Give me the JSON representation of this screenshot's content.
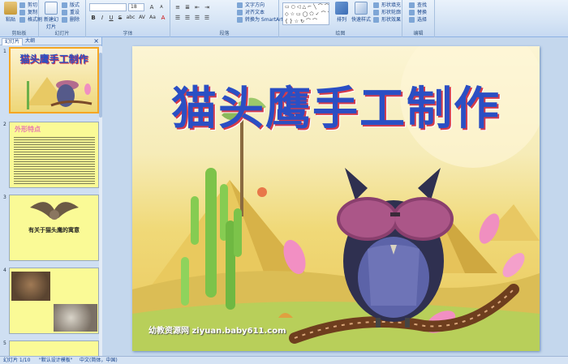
{
  "ribbon": {
    "clipboard": {
      "paste": "粘贴",
      "cut": "剪切",
      "copy": "复制",
      "format_painter": "格式刷",
      "label": "剪贴板"
    },
    "slides": {
      "new_slide": "新建幻灯片",
      "layout": "版式",
      "reset": "重设",
      "delete": "删除",
      "label": "幻灯片"
    },
    "font": {
      "family": "",
      "size": "18",
      "bold": "B",
      "italic": "I",
      "underline": "U",
      "strike": "S",
      "shadow": "abc",
      "spacing": "AV",
      "case": "Aa",
      "grow": "A",
      "shrink": "A",
      "clear": "A",
      "color": "A",
      "label": "字体"
    },
    "paragraph": {
      "text_direction": "文字方向",
      "align_text": "对齐文本",
      "smartart": "转换为 SmartArt",
      "label": "段落"
    },
    "drawing": {
      "arrange": "排列",
      "quick_styles": "快速样式",
      "shape_fill": "形状填充",
      "shape_outline": "形状轮廓",
      "shape_effects": "形状效果",
      "label": "绘图"
    },
    "editing": {
      "find": "查找",
      "replace": "替换",
      "select": "选择",
      "label": "编辑"
    }
  },
  "panel": {
    "tab_slides": "幻灯片",
    "tab_outline": "大纲",
    "close": "×",
    "thumbs": [
      {
        "num": "1",
        "title": "猫头鹰手工制作"
      },
      {
        "num": "2",
        "title": "外形特点"
      },
      {
        "num": "3",
        "title": "有关于猫头鹰的寓意"
      },
      {
        "num": "4"
      },
      {
        "num": "5"
      }
    ]
  },
  "slide": {
    "title": "猫头鹰手工制作",
    "watermark": "幼教资源网 ziyuan.baby611.com"
  },
  "status": {
    "slide_count": "幻灯片 1/10",
    "theme": "\"默认设计模板\"",
    "language": "中文(简体，中国)"
  },
  "colors": {
    "title": "#2a4fc4",
    "title_shadow": "#d43c4a",
    "selected_border": "#f5a623",
    "thumb_bg": "#fafa96"
  }
}
